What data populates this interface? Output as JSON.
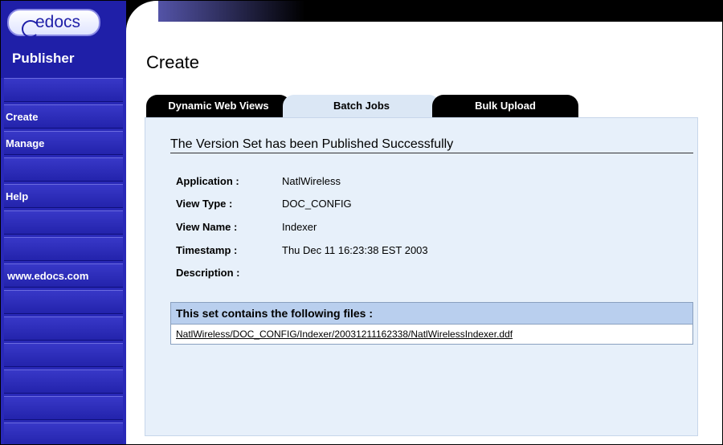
{
  "app": {
    "logo_text": "edocs",
    "product_name": "Publisher"
  },
  "sidebar": {
    "items": [
      {
        "label": ""
      },
      {
        "label": "Create"
      },
      {
        "label": "Manage"
      },
      {
        "label": ""
      },
      {
        "label": "Help"
      },
      {
        "label": ""
      },
      {
        "label": ""
      },
      {
        "label": "www.edocs.com"
      },
      {
        "label": ""
      },
      {
        "label": ""
      },
      {
        "label": ""
      },
      {
        "label": ""
      },
      {
        "label": ""
      },
      {
        "label": ""
      }
    ]
  },
  "page": {
    "title": "Create"
  },
  "tabs": [
    {
      "label": "Dynamic Web Views",
      "active": false
    },
    {
      "label": "Batch Jobs",
      "active": true
    },
    {
      "label": "Bulk Upload",
      "active": false
    }
  ],
  "result": {
    "headline": "The Version Set has been Published Successfully",
    "fields": [
      {
        "label": "Application :",
        "value": "NatlWireless"
      },
      {
        "label": "View Type :",
        "value": "DOC_CONFIG"
      },
      {
        "label": "View Name :",
        "value": "Indexer"
      },
      {
        "label": "Timestamp :",
        "value": "Thu Dec 11 16:23:38 EST 2003"
      },
      {
        "label": "Description :",
        "value": ""
      }
    ],
    "files_header": "This set contains the following files :",
    "files": [
      "NatlWireless/DOC_CONFIG/Indexer/20031211162338/NatlWirelessIndexer.ddf"
    ]
  },
  "colors": {
    "sidebar": "#2929b8",
    "panel": "#e7f0fa",
    "files_header": "#b9cfee"
  }
}
